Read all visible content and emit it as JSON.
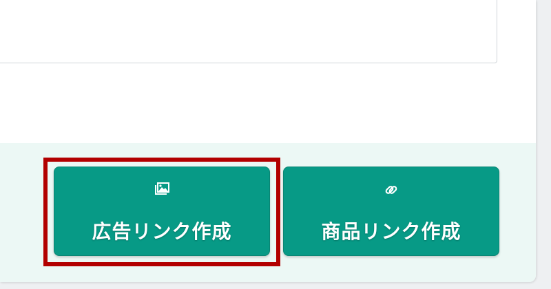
{
  "footer": {
    "buttons": [
      {
        "label": "広告リンク作成",
        "icon": "images-icon"
      },
      {
        "label": "商品リンク作成",
        "icon": "link-icon"
      }
    ]
  },
  "colors": {
    "button": "#079a86",
    "footer": "#ecf8f5",
    "highlight": "#b20000"
  }
}
